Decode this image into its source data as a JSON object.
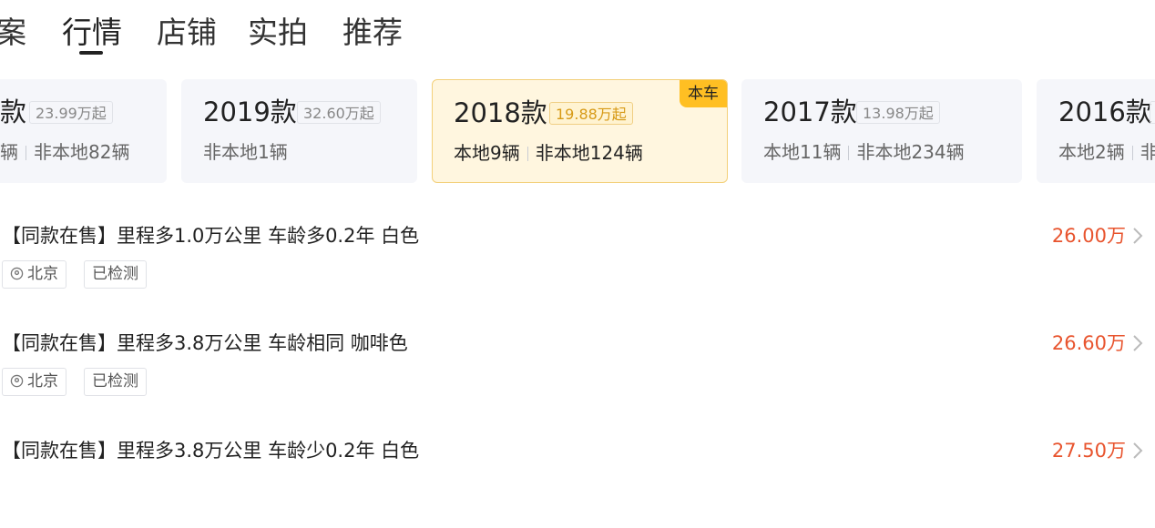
{
  "tabs": [
    "案",
    "行情",
    "店铺",
    "实拍",
    "推荐"
  ],
  "active_tab": "行情",
  "cards": [
    {
      "year": "款",
      "price": "23.99万起",
      "stock_a": "辆",
      "stock_b": "非本地82辆"
    },
    {
      "year": "2019款",
      "price": "32.60万起",
      "stock_a": "",
      "stock_b": "非本地1辆"
    },
    {
      "year": "2018款",
      "price": "19.88万起",
      "stock_a": "本地9辆",
      "stock_b": "非本地124辆",
      "badge": "本车"
    },
    {
      "year": "2017款",
      "price": "13.98万起",
      "stock_a": "本地11辆",
      "stock_b": "非本地234辆"
    },
    {
      "year": "2016款",
      "price": "",
      "stock_a": "本地2辆",
      "stock_b": "非"
    }
  ],
  "listings": [
    {
      "title": "【同款在售】里程多1.0万公里 车龄多0.2年 白色",
      "price": "26.00万",
      "location": "北京",
      "inspected": "已检测"
    },
    {
      "title": "【同款在售】里程多3.8万公里 车龄相同 咖啡色",
      "price": "26.60万",
      "location": "北京",
      "inspected": "已检测"
    },
    {
      "title": "【同款在售】里程多3.8万公里 车龄少0.2年 白色",
      "price": "27.50万"
    }
  ],
  "colors": {
    "price_red": "#e8542e",
    "selected_bg": "#fff6df",
    "badge_yellow": "#ffbf23",
    "selected_price": "#d79a16"
  },
  "icons": {
    "location": "location-pin-icon",
    "chevron": "chevron-right-icon"
  }
}
